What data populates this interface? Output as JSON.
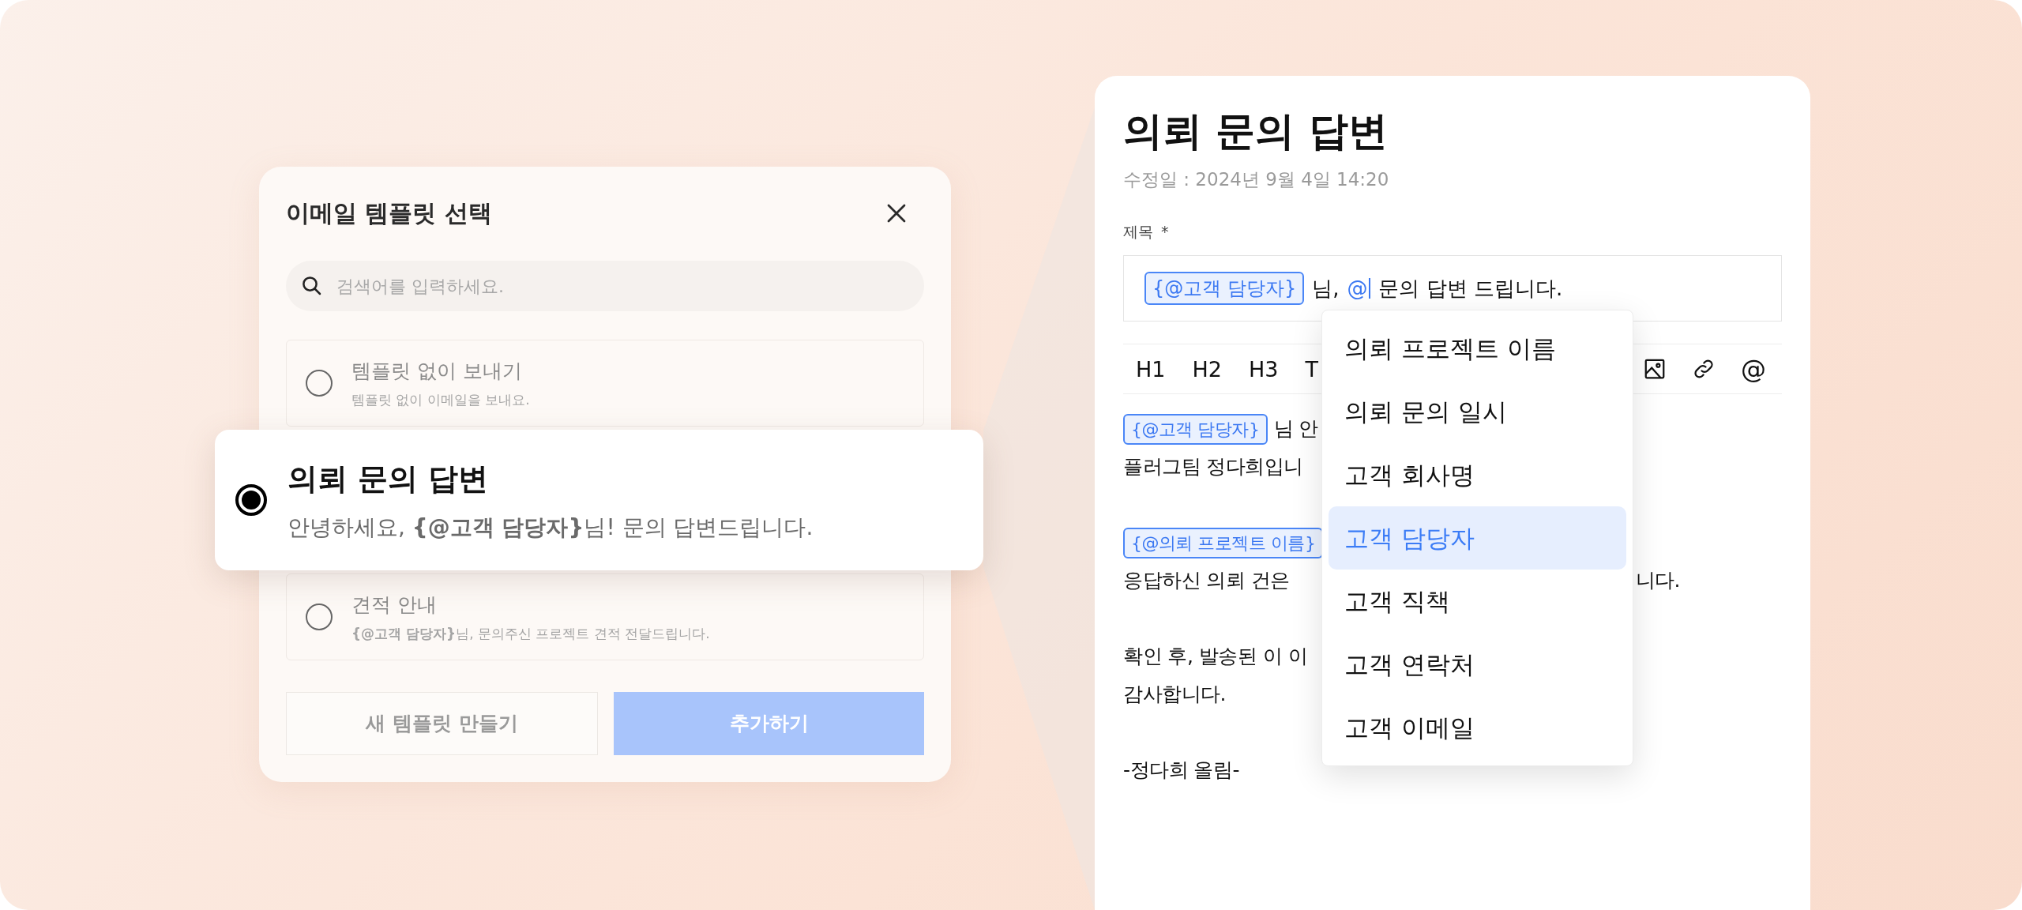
{
  "modal": {
    "title": "이메일 템플릿 선택",
    "search": {
      "placeholder": "검색어를 입력하세요."
    },
    "templates": [
      {
        "title": "템플릿 없이 보내기",
        "description": "템플릿 없이 이메일을 보내요.",
        "selected": false
      },
      {
        "title": "의뢰 문의 답변",
        "description": "안녕하세요, **{@고객 담당자}**님! 문의 답변드립니다.",
        "selected": true
      },
      {
        "title": "견적 안내",
        "description": "**{@고객 담당자}**님, 문의주신 프로젝트 견적 전달드립니다.",
        "selected": false
      }
    ],
    "buttons": [
      {
        "label": "새 템플릿 만들기",
        "kind": "secondary"
      },
      {
        "label": "추가하기",
        "kind": "primary"
      }
    ]
  },
  "editor": {
    "title": "의뢰 문의 답변",
    "modified": "수정일 : 2024년 9월 4일 14:20",
    "subject": {
      "label": "제목",
      "required_mark": "*",
      "segments": [
        {
          "kind": "token",
          "text": "{@고객 담당자}"
        },
        {
          "kind": "text",
          "text": "님,"
        },
        {
          "kind": "mention",
          "text": "@"
        },
        {
          "kind": "text",
          "text": "문의 답변 드립니다."
        }
      ]
    },
    "toolbar_left": [
      "H1",
      "H2",
      "H3",
      "T"
    ],
    "toolbar_right": [
      {
        "kind": "image"
      },
      {
        "kind": "link"
      },
      {
        "kind": "text",
        "text": "@"
      }
    ],
    "paragraphs": [
      [
        {
          "segments": [
            {
              "kind": "token",
              "text": "{@고객 담당자}"
            },
            {
              "kind": "text",
              "text": "님 안"
            }
          ]
        },
        {
          "segments": [
            {
              "kind": "text",
              "text": "플러그팀 정다희입니"
            }
          ]
        }
      ],
      [
        {
          "segments": [
            {
              "kind": "token",
              "text": "{@의뢰 프로젝트 이름}"
            }
          ]
        },
        {
          "segments": [
            {
              "kind": "text",
              "text": "응답하신 의뢰 건은"
            }
          ],
          "trailing": "니다."
        }
      ],
      [
        {
          "segments": [
            {
              "kind": "text",
              "text": "확인 후, 발송된 이 이"
            }
          ]
        },
        {
          "segments": [
            {
              "kind": "text",
              "text": "감사합니다."
            }
          ]
        }
      ],
      [
        {
          "segments": [
            {
              "kind": "text",
              "text": "-정다희 올림-"
            }
          ]
        }
      ]
    ],
    "mention_menu": [
      {
        "label": "의뢰 프로젝트 이름",
        "selected": false
      },
      {
        "label": "의뢰 문의 일시",
        "selected": false
      },
      {
        "label": "고객 회사명",
        "selected": false
      },
      {
        "label": "고객 담당자",
        "selected": true
      },
      {
        "label": "고객 직책",
        "selected": false
      },
      {
        "label": "고객 연락처",
        "selected": false
      },
      {
        "label": "고객 이메일",
        "selected": false
      }
    ]
  }
}
